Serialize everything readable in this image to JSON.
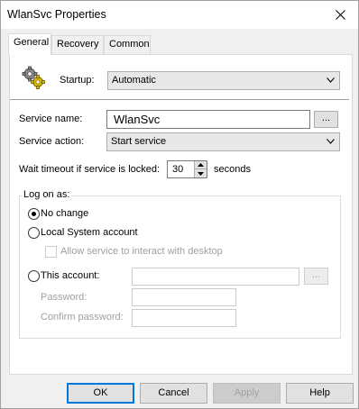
{
  "window": {
    "title": "WlanSvc Properties"
  },
  "tabs": [
    {
      "label": "General",
      "active": true
    },
    {
      "label": "Recovery",
      "active": false
    },
    {
      "label": "Common",
      "active": false
    }
  ],
  "general": {
    "startup_label": "Startup:",
    "startup_value": "Automatic",
    "service_name_label": "Service name:",
    "service_name_value": "WlanSvc",
    "service_name_browse": "...",
    "service_action_label": "Service action:",
    "service_action_value": "Start service",
    "wait_timeout_label": "Wait timeout if service is locked:",
    "wait_timeout_value": "30",
    "wait_timeout_unit": "seconds"
  },
  "logon": {
    "group_title": "Log on as:",
    "no_change_label": "No change",
    "no_change_selected": true,
    "local_system_label": "Local System account",
    "local_system_selected": false,
    "allow_interact_label": "Allow service to interact with desktop",
    "allow_interact_checked": false,
    "this_account_label": "This account:",
    "this_account_selected": false,
    "this_account_value": "",
    "this_account_browse": "...",
    "password_label": "Password:",
    "password_value": "",
    "confirm_password_label": "Confirm password:",
    "confirm_password_value": ""
  },
  "buttons": {
    "ok": "OK",
    "cancel": "Cancel",
    "apply": "Apply",
    "help": "Help"
  },
  "icons": {
    "close": "close-icon",
    "service": "gears-icon",
    "dropdown": "chevron-down-icon"
  }
}
